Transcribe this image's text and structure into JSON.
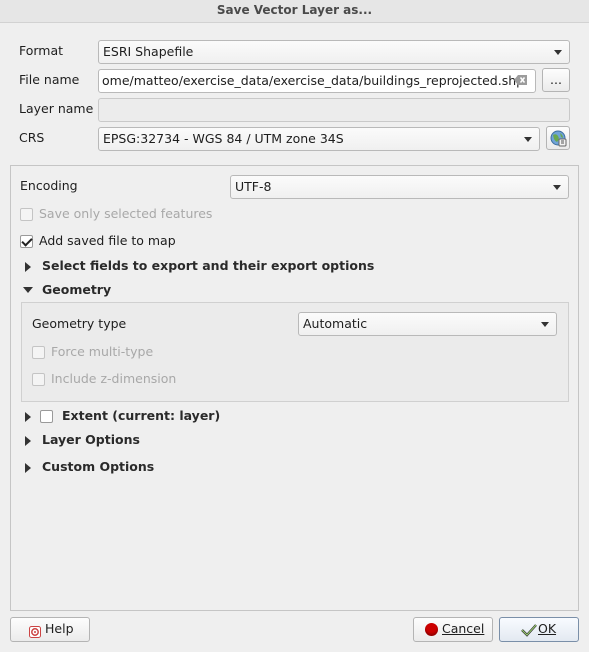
{
  "window": {
    "title": "Save Vector Layer as..."
  },
  "form": {
    "format_label": "Format",
    "format_value": "ESRI Shapefile",
    "filename_label": "File name",
    "filename_value": "ome/matteo/exercise_data/exercise_data/buildings_reprojected.shp",
    "browse_label": "...",
    "layername_label": "Layer name",
    "layername_value": "",
    "crs_label": "CRS",
    "crs_value": "EPSG:32734 - WGS 84 / UTM zone 34S"
  },
  "options": {
    "encoding_label": "Encoding",
    "encoding_value": "UTF-8",
    "save_selected_label": "Save only selected features",
    "save_selected_checked": false,
    "add_to_map_label": "Add saved file to map",
    "add_to_map_checked": true,
    "select_fields_label": "Select fields to export and their export options",
    "geometry_label": "Geometry",
    "geometry_type_label": "Geometry type",
    "geometry_type_value": "Automatic",
    "force_multi_label": "Force multi-type",
    "include_z_label": "Include z-dimension",
    "extent_label": "Extent (current: layer)",
    "layer_options_label": "Layer Options",
    "custom_options_label": "Custom Options"
  },
  "buttons": {
    "help": "Help",
    "cancel": "Cancel",
    "ok": "OK"
  },
  "colors": {
    "background": "#efefef",
    "cancel_icon": "#cc0000"
  }
}
